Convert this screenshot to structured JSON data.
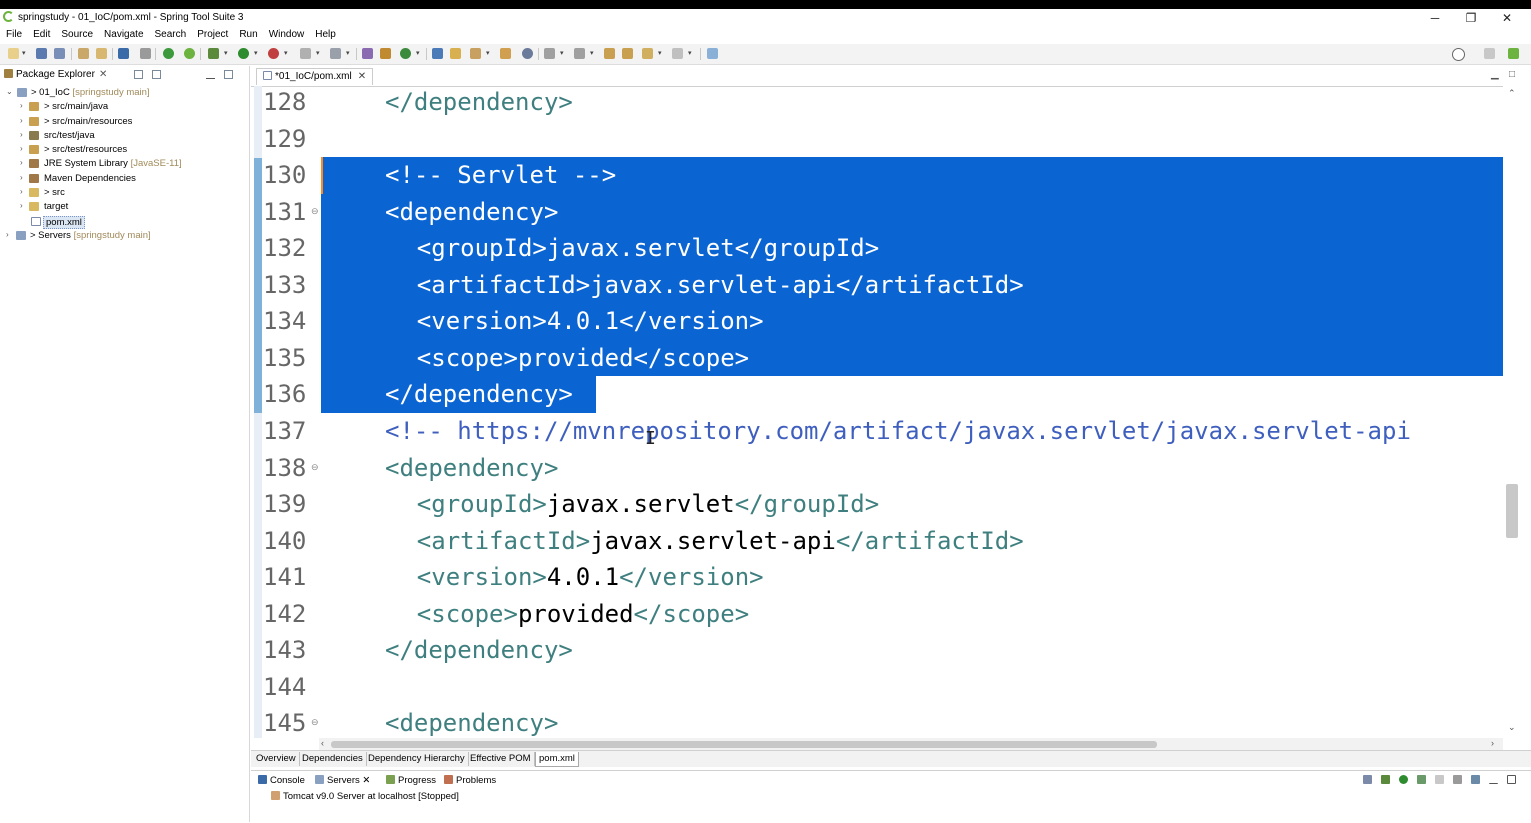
{
  "window": {
    "title": "springstudy - 01_IoC/pom.xml - Spring Tool Suite 3",
    "minimize": "─",
    "restore": "❐",
    "close": "✕"
  },
  "menu": [
    "File",
    "Edit",
    "Source",
    "Navigate",
    "Search",
    "Project",
    "Run",
    "Window",
    "Help"
  ],
  "package_explorer": {
    "tab_label": "Package Explorer",
    "close": "✕",
    "items": [
      {
        "label": "> 01_IoC",
        "extra": "[springstudy main]",
        "arrow": "⌄"
      },
      {
        "label": "> src/main/java",
        "extra": "",
        "arrow": "›"
      },
      {
        "label": "> src/main/resources",
        "extra": "",
        "arrow": "›"
      },
      {
        "label": "src/test/java",
        "extra": "",
        "arrow": "›"
      },
      {
        "label": "> src/test/resources",
        "extra": "",
        "arrow": "›"
      },
      {
        "label": "JRE System Library",
        "extra": "[JavaSE-11]",
        "arrow": "›"
      },
      {
        "label": "Maven Dependencies",
        "extra": "",
        "arrow": "›"
      },
      {
        "label": "> src",
        "extra": "",
        "arrow": "›"
      },
      {
        "label": "target",
        "extra": "",
        "arrow": "›"
      },
      {
        "label": "pom.xml",
        "extra": "",
        "arrow": ""
      },
      {
        "label": "> Servers",
        "extra": "[springstudy main]",
        "arrow": "›"
      }
    ]
  },
  "editor": {
    "tab_label": "*01_IoC/pom.xml",
    "tab_close": "✕",
    "lines": [
      {
        "num": "128",
        "text": "</dependency>",
        "indent": 0
      },
      {
        "num": "129",
        "text": "",
        "indent": 0
      },
      {
        "num": "130",
        "text": "<!-- Servlet -->",
        "indent": 0
      },
      {
        "num": "131",
        "text": "<dependency>",
        "indent": 0
      },
      {
        "num": "132",
        "text": "<groupId>javax.servlet</groupId>",
        "indent": 1
      },
      {
        "num": "133",
        "text": "<artifactId>javax.servlet-api</artifactId>",
        "indent": 1
      },
      {
        "num": "134",
        "text": "<version>4.0.1</version>",
        "indent": 1
      },
      {
        "num": "135",
        "text": "<scope>provided</scope>",
        "indent": 1
      },
      {
        "num": "136",
        "text": "</dependency>",
        "indent": 0
      },
      {
        "num": "137",
        "text": "<!-- https://mvnrepository.com/artifact/javax.servlet/javax.servlet-api",
        "indent": 0
      },
      {
        "num": "138",
        "text": "<dependency>",
        "indent": 0
      },
      {
        "num": "139",
        "text": "<groupId>javax.servlet</groupId>",
        "indent": 1
      },
      {
        "num": "140",
        "text": "<artifactId>javax.servlet-api</artifactId>",
        "indent": 1
      },
      {
        "num": "141",
        "text": "<version>4.0.1</version>",
        "indent": 1
      },
      {
        "num": "142",
        "text": "<scope>provided</scope>",
        "indent": 1
      },
      {
        "num": "143",
        "text": "</dependency>",
        "indent": 0
      },
      {
        "num": "144",
        "text": "",
        "indent": 0
      },
      {
        "num": "145",
        "text": "<dependency>",
        "indent": 0
      }
    ],
    "highlight_color": "#0a64d2"
  },
  "pom_tabs": [
    "Overview",
    "Dependencies",
    "Dependency Hierarchy",
    "Effective POM",
    "pom.xml"
  ],
  "bottom": {
    "tabs": [
      {
        "label": "Console",
        "close": ""
      },
      {
        "label": "Servers",
        "close": "✕"
      },
      {
        "label": "Progress",
        "close": ""
      },
      {
        "label": "Problems",
        "close": ""
      }
    ],
    "server_row": "Tomcat v9.0 Server at localhost  [Stopped]"
  }
}
